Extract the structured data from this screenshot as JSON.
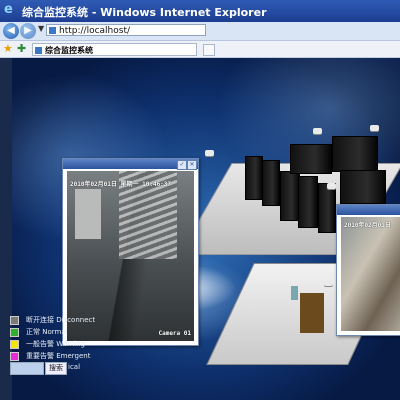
{
  "window": {
    "title": "综合监控系统 - Windows Internet Explorer",
    "ie_glyph": "e"
  },
  "address_bar": {
    "url": "http://localhost/"
  },
  "tab": {
    "label": "综合监控系统"
  },
  "cameras": [
    {
      "osd_time": "2010年02月01日 星期一 10:46:37",
      "name": "Camera 01"
    },
    {
      "osd_time": "2010年02月01日"
    }
  ],
  "legend": [
    {
      "label": "断开连接 Disconnect",
      "color": "#7a7a7a"
    },
    {
      "label": "正常 Normal",
      "color": "#2fae2f"
    },
    {
      "label": "一般告警 Warning",
      "color": "#f4e500"
    },
    {
      "label": "重要告警 Emergent",
      "color": "#e42bd8"
    }
  ],
  "search": {
    "button_label": "搜索",
    "tail": "ical"
  }
}
